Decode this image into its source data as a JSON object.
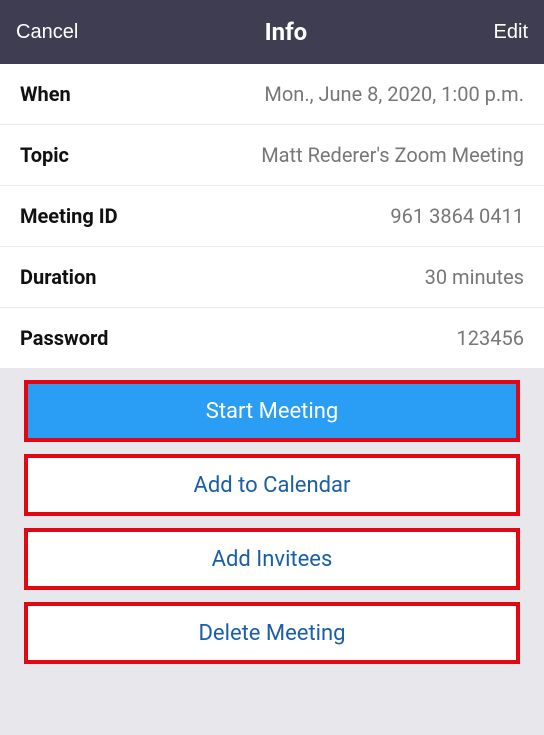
{
  "header": {
    "cancel": "Cancel",
    "title": "Info",
    "edit": "Edit"
  },
  "details": {
    "when_label": "When",
    "when_value": "Mon., June 8, 2020, 1:00 p.m.",
    "topic_label": "Topic",
    "topic_value": "Matt Rederer's Zoom Meeting",
    "meeting_id_label": "Meeting ID",
    "meeting_id_value": "961 3864 0411",
    "duration_label": "Duration",
    "duration_value": "30 minutes",
    "password_label": "Password",
    "password_value": "123456"
  },
  "actions": {
    "start": "Start Meeting",
    "add_calendar": "Add to Calendar",
    "add_invitees": "Add Invitees",
    "delete": "Delete Meeting"
  }
}
